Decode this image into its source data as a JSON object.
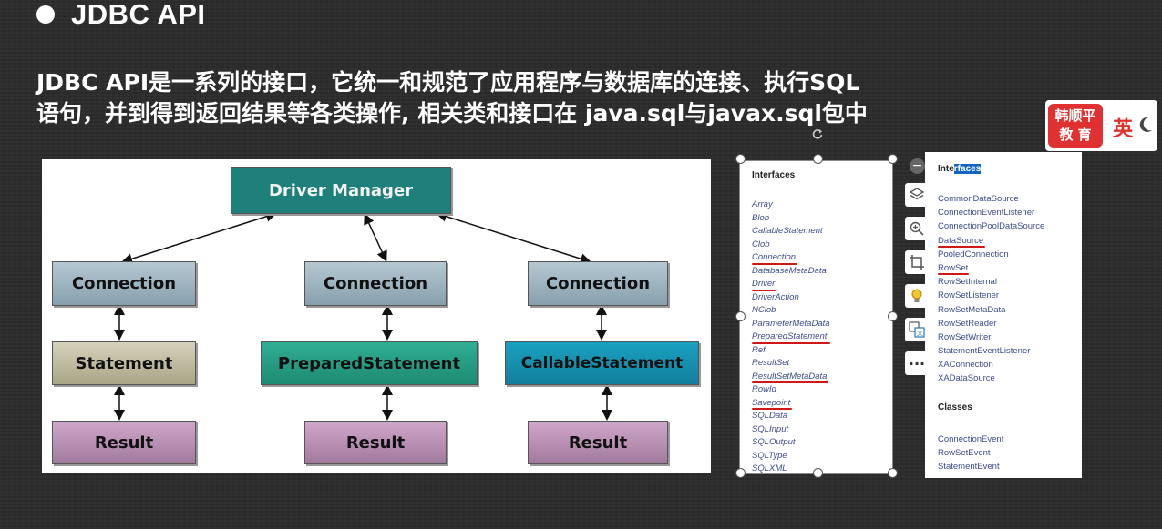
{
  "slide": {
    "heading": "JDBC API",
    "description_line1": "JDBC API是一系列的接口，它统一和规范了应用程序与数据库的连接、执行SQL",
    "description_line2": "语句，并到得到返回结果等各类操作, 相关类和接口在 java.sql与javax.sql包中"
  },
  "diagram": {
    "driver_manager": "Driver Manager",
    "connection_1": "Connection",
    "connection_2": "Connection",
    "connection_3": "Connection",
    "statement": "Statement",
    "prepared_statement": "PreparedStatement",
    "callable_statement": "CallableStatement",
    "result_1": "Result",
    "result_2": "Result",
    "result_3": "Result"
  },
  "java_sql_panel": {
    "title": "Interfaces",
    "items": [
      "Array",
      "Blob",
      "CallableStatement",
      "Clob",
      "Connection",
      "DatabaseMetaData",
      "Driver",
      "DriverAction",
      "NClob",
      "ParameterMetaData",
      "PreparedStatement",
      "Ref",
      "ResultSet",
      "ResultSetMetaData",
      "RowId",
      "Savepoint",
      "SQLData",
      "SQLInput",
      "SQLOutput",
      "SQLType",
      "SQLXML"
    ]
  },
  "javax_sql_panel": {
    "title_part1": "Inte",
    "title_part2": "rfaces",
    "items": [
      "CommonDataSource",
      "ConnectionEventListener",
      "ConnectionPoolDataSource",
      "DataSource",
      "PooledConnection",
      "RowSet",
      "RowSetInternal",
      "RowSetListener",
      "RowSetMetaData",
      "RowSetReader",
      "RowSetWriter",
      "StatementEventListener",
      "XAConnection",
      "XADataSource"
    ],
    "classes_title": "Classes",
    "classes": [
      "ConnectionEvent",
      "RowSetEvent",
      "StatementEvent"
    ]
  },
  "badge": {
    "logo_line1": "韩顺平",
    "logo_line2": "教 育",
    "language": "英"
  },
  "toolbar": {
    "more_label": "···"
  },
  "icons": [
    "minus-icon",
    "layers-icon",
    "zoom-in-icon",
    "crop-icon",
    "lightbulb-icon",
    "translate-icon",
    "more-icon",
    "rotate-icon",
    "moon-icon"
  ],
  "colors": {
    "background": "#2b2b2b",
    "driver_manager": "#1f7f7b",
    "underline": "#d01818",
    "link": "#3d4d8c",
    "highlight": "#1565c0",
    "badge_red": "#e03030"
  }
}
